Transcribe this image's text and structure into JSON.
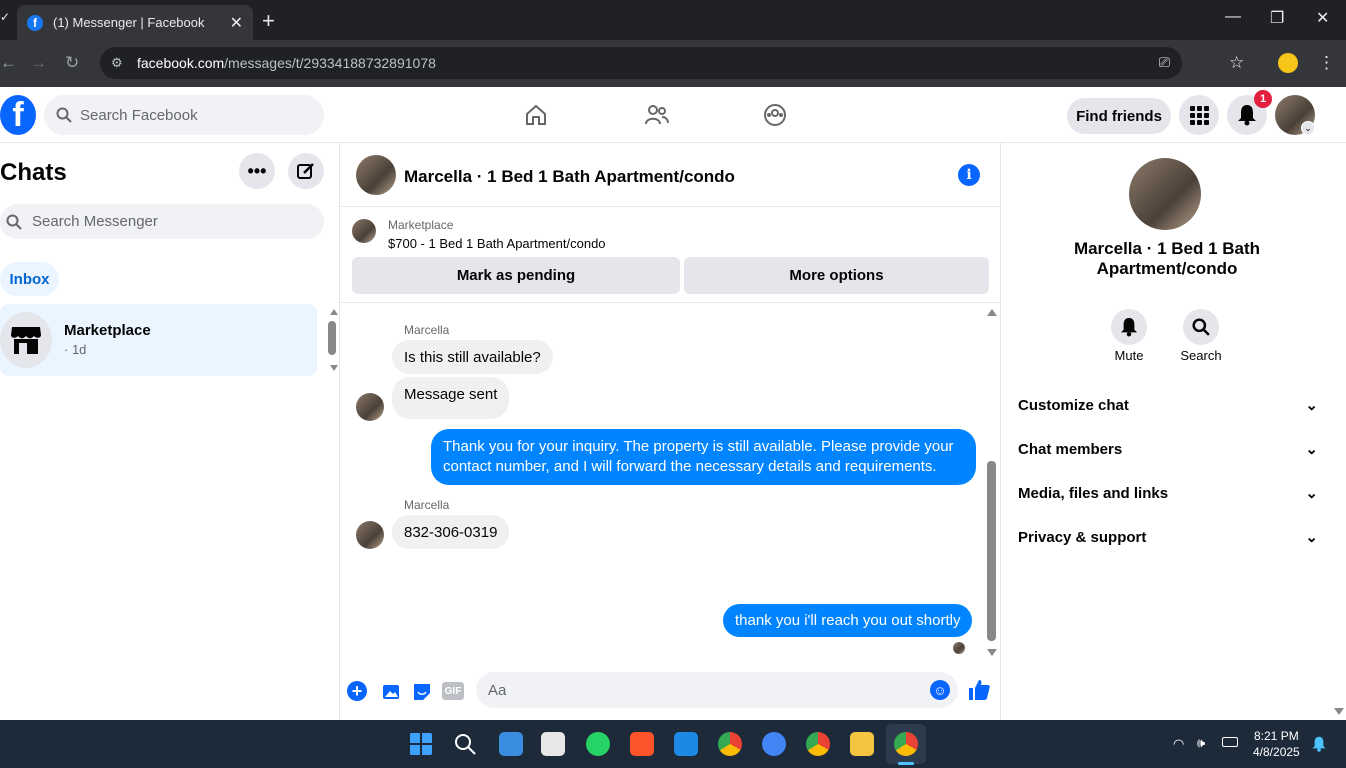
{
  "browser": {
    "tab_title": "(1) Messenger | Facebook",
    "url_host": "facebook.com",
    "url_path": "/messages/t/29334188732891078"
  },
  "header": {
    "search_placeholder": "Search Facebook",
    "find_friends": "Find friends",
    "notification_count": "1"
  },
  "left": {
    "title": "Chats",
    "search_placeholder": "Search Messenger",
    "inbox_label": "Inbox",
    "conversations": [
      {
        "name": "Marketplace",
        "time": "· 1d"
      }
    ]
  },
  "conversation": {
    "title": "Marcella · 1 Bed 1 Bath Apartment/condo",
    "marketplace_label": "Marketplace",
    "listing": "$700 - 1 Bed 1 Bath Apartment/condo",
    "mark_pending": "Mark as pending",
    "more_options": "More options",
    "messages": [
      {
        "sender": "Marcella",
        "text": "Is this still available?",
        "direction": "in"
      },
      {
        "text": "Message sent",
        "direction": "in"
      },
      {
        "text": "Thank you for your inquiry. The property is still available. Please provide your contact number, and I will forward the necessary details and requirements.",
        "direction": "out"
      },
      {
        "sender": "Marcella",
        "text": "832-306-0319",
        "direction": "in"
      },
      {
        "text": "thank you i'll reach you out shortly",
        "direction": "out"
      }
    ],
    "composer_placeholder": "Aa",
    "gif_label": "GIF"
  },
  "right": {
    "title": "Marcella · 1 Bed 1 Bath Apartment/condo",
    "mute": "Mute",
    "search": "Search",
    "sections": [
      "Customize chat",
      "Chat members",
      "Media, files and links",
      "Privacy & support"
    ]
  },
  "taskbar": {
    "time": "8:21 PM",
    "date": "4/8/2025"
  },
  "colors": {
    "fb_blue": "#0866ff",
    "bubble_out": "#0084ff",
    "badge_red": "#e41e3f"
  }
}
